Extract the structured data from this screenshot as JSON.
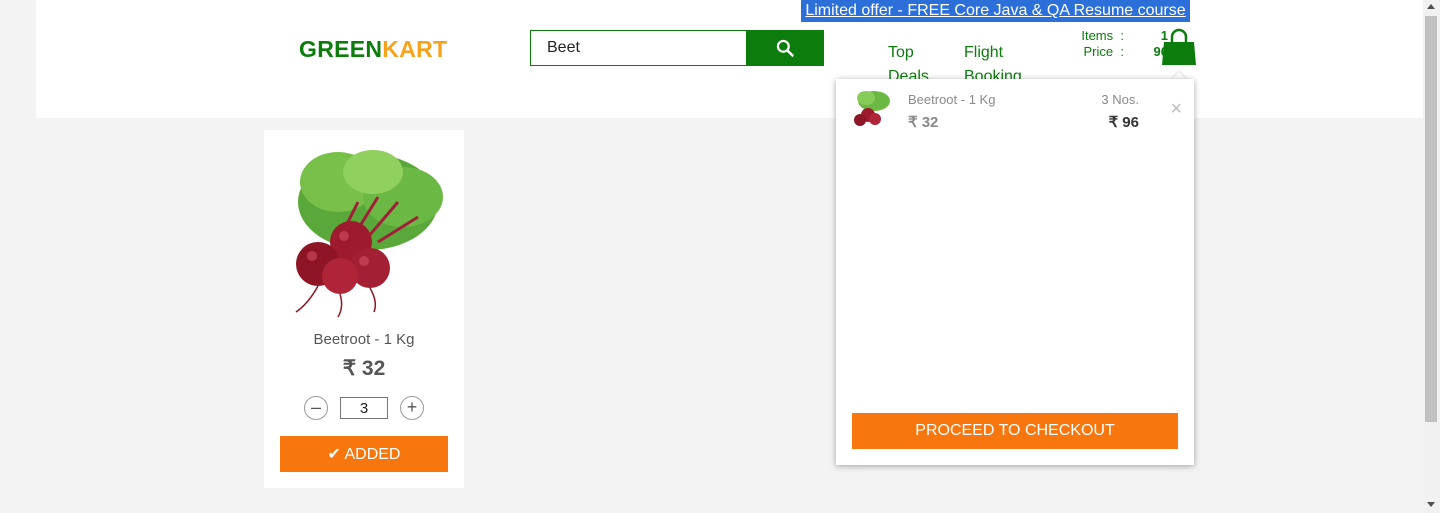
{
  "header": {
    "logo_part1": "GREEN",
    "logo_part2": "KART",
    "promo_text": "Limited offer - FREE Core Java & QA Resume course",
    "search": {
      "value": "Beet",
      "icon": "search-icon"
    },
    "nav": [
      {
        "label": "Top Deals"
      },
      {
        "label": "Flight Booking"
      }
    ],
    "cart_info": {
      "items_label": "Items",
      "items_count": "1",
      "price_label": "Price",
      "price_value": "96",
      "separator": ":"
    },
    "cart_icon": "shopping-bag-icon"
  },
  "cart_preview": {
    "items": [
      {
        "name": "Beetroot - 1 Kg",
        "unit_price": "₹ 32",
        "quantity": "3 Nos.",
        "amount": "₹ 96",
        "remove_icon": "×"
      }
    ],
    "checkout_label": "PROCEED TO CHECKOUT"
  },
  "products": [
    {
      "name": "Beetroot - 1 Kg",
      "price": "₹ 32",
      "quantity": "3",
      "decrement": "–",
      "increment": "+",
      "button_label": "✔ ADDED"
    }
  ],
  "colors": {
    "brand_green": "#0c7d0c",
    "brand_orange": "#f7a21b",
    "button_orange": "#f7760e",
    "promo_blue": "#2d6fd8"
  }
}
